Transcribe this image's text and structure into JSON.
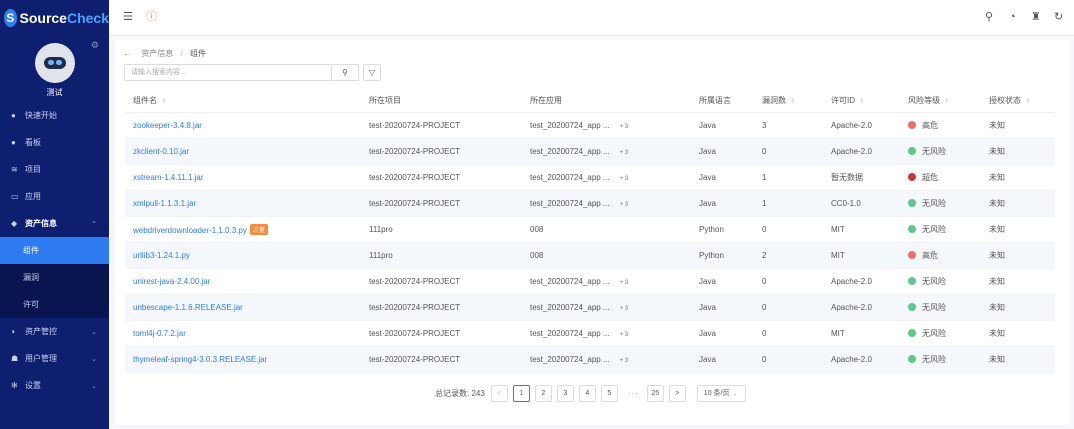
{
  "app": {
    "brand_letter": "S",
    "brand_part1": "Source",
    "brand_part2": "Check",
    "user_name": "测试"
  },
  "sidebar": {
    "items": [
      {
        "label": "快速开始",
        "icon": "rocket-icon"
      },
      {
        "label": "看板",
        "icon": "dashboard-icon"
      },
      {
        "label": "项目",
        "icon": "layers-icon"
      },
      {
        "label": "应用",
        "icon": "monitor-icon"
      },
      {
        "label": "资产信息",
        "icon": "box-icon"
      },
      {
        "label": "资产管控",
        "icon": "shield-icon"
      },
      {
        "label": "用户管理",
        "icon": "users-icon"
      },
      {
        "label": "设置",
        "icon": "gear-icon"
      }
    ],
    "sub_items": [
      {
        "label": "组件"
      },
      {
        "label": "漏洞"
      },
      {
        "label": "许可"
      }
    ]
  },
  "breadcrumb": {
    "root": "资产信息",
    "separator": "/",
    "current": "组件"
  },
  "search": {
    "placeholder": "请输入搜索内容..."
  },
  "table": {
    "headers": [
      "组件名",
      "所在项目",
      "所在应用",
      "所属语言",
      "漏洞数",
      "许可ID",
      "风险等级",
      "授权状态"
    ],
    "rows": [
      {
        "component": "zookeeper-3.4.8.jar",
        "project": "test-20200724-PROJECT",
        "app": "test_20200724_app ...",
        "more": "+ 3",
        "lang": "Java",
        "vulns": "3",
        "license": "Apache-2.0",
        "risk": "高危",
        "risk_color": "#f56c6c",
        "auth": "未知",
        "tag": ""
      },
      {
        "component": "zkclient-0.10.jar",
        "project": "test-20200724-PROJECT",
        "app": "test_20200724_app ...",
        "more": "+ 3",
        "lang": "Java",
        "vulns": "0",
        "license": "Apache-2.0",
        "risk": "无风险",
        "risk_color": "#5cc98a",
        "auth": "未知",
        "tag": ""
      },
      {
        "component": "xstream-1.4.11.1.jar",
        "project": "test-20200724-PROJECT",
        "app": "test_20200724_app ...",
        "more": "+ 3",
        "lang": "Java",
        "vulns": "1",
        "license": "暂无数据",
        "risk": "超危",
        "risk_color": "#c7363b",
        "auth": "未知",
        "tag": ""
      },
      {
        "component": "xmlpull-1.1.3.1.jar",
        "project": "test-20200724-PROJECT",
        "app": "test_20200724_app ...",
        "more": "+ 3",
        "lang": "Java",
        "vulns": "1",
        "license": "CC0-1.0",
        "risk": "无风险",
        "risk_color": "#5cc98a",
        "auth": "未知",
        "tag": ""
      },
      {
        "component": "webdriverdownloader-1.1.0.3.py",
        "project": "111pro",
        "app": "008",
        "more": "",
        "lang": "Python",
        "vulns": "0",
        "license": "MIT",
        "risk": "无风险",
        "risk_color": "#5cc98a",
        "auth": "未知",
        "tag": "古董"
      },
      {
        "component": "urllib3-1.24.1.py",
        "project": "111pro",
        "app": "008",
        "more": "",
        "lang": "Python",
        "vulns": "2",
        "license": "MIT",
        "risk": "高危",
        "risk_color": "#f56c6c",
        "auth": "未知",
        "tag": ""
      },
      {
        "component": "unirest-java-2.4.00.jar",
        "project": "test-20200724-PROJECT",
        "app": "test_20200724_app ...",
        "more": "+ 3",
        "lang": "Java",
        "vulns": "0",
        "license": "Apache-2.0",
        "risk": "无风险",
        "risk_color": "#5cc98a",
        "auth": "未知",
        "tag": ""
      },
      {
        "component": "unbescape-1.1.6.RELEASE.jar",
        "project": "test-20200724-PROJECT",
        "app": "test_20200724_app ...",
        "more": "+ 3",
        "lang": "Java",
        "vulns": "0",
        "license": "Apache-2.0",
        "risk": "无风险",
        "risk_color": "#5cc98a",
        "auth": "未知",
        "tag": ""
      },
      {
        "component": "toml4j-0.7.2.jar",
        "project": "test-20200724-PROJECT",
        "app": "test_20200724_app ...",
        "more": "+ 3",
        "lang": "Java",
        "vulns": "0",
        "license": "MIT",
        "risk": "无风险",
        "risk_color": "#5cc98a",
        "auth": "未知",
        "tag": ""
      },
      {
        "component": "thymeleaf-spring4-3.0.3.RELEASE.jar",
        "project": "test-20200724-PROJECT",
        "app": "test_20200724_app ...",
        "more": "+ 3",
        "lang": "Java",
        "vulns": "0",
        "license": "Apache-2.0",
        "risk": "无风险",
        "risk_color": "#5cc98a",
        "auth": "未知",
        "tag": ""
      }
    ]
  },
  "pagination": {
    "total_label": "总记录数: 243",
    "prev": "<",
    "next": ">",
    "pages": [
      "1",
      "2",
      "3",
      "4",
      "5"
    ],
    "ellipsis": "···",
    "last": "25",
    "current_page": "1",
    "page_size": "10 条/页"
  }
}
